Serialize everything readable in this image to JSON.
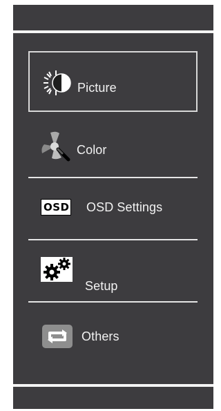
{
  "menu": {
    "items": [
      {
        "label": "Picture",
        "icon": "brightness-contrast-icon",
        "selected": true
      },
      {
        "label": "Color",
        "icon": "color-wheel-icon",
        "selected": false
      },
      {
        "label": "OSD Settings",
        "icon": "osd-icon",
        "icon_text": "OSD",
        "selected": false
      },
      {
        "label": "Setup",
        "icon": "gears-icon",
        "selected": false
      },
      {
        "label": "Others",
        "icon": "refresh-icon",
        "selected": false
      }
    ]
  },
  "colors": {
    "panel_bg": "#3d3c3f",
    "text": "#f2f2f2",
    "highlight_border": "#d9d9d9"
  }
}
